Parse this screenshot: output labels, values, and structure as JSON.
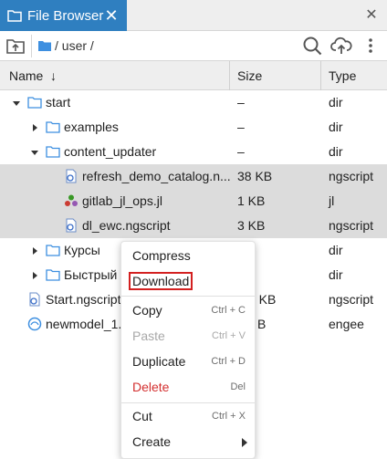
{
  "tab": {
    "title": "File Browser",
    "close_glyph": "✕"
  },
  "panel": {
    "close_glyph": "✕"
  },
  "toolbar": {
    "path": "/ user /"
  },
  "header": {
    "name": "Name",
    "sort_glyph": "↓",
    "size": "Size",
    "type": "Type"
  },
  "rows": [
    {
      "name": "start",
      "size": "–",
      "type": "dir"
    },
    {
      "name": "examples",
      "size": "–",
      "type": "dir"
    },
    {
      "name": "content_updater",
      "size": "–",
      "type": "dir"
    },
    {
      "name": "refresh_demo_catalog.n...",
      "size": "38 KB",
      "type": "ngscript"
    },
    {
      "name": "gitlab_jl_ops.jl",
      "size": "1 KB",
      "type": "jl"
    },
    {
      "name": "dl_ewc.ngscript",
      "size": "3 KB",
      "type": "ngscript"
    },
    {
      "name": "Курсы",
      "size": "",
      "type": "dir"
    },
    {
      "name": "Быстрый",
      "size": "",
      "type": "dir"
    },
    {
      "name": "Start.ngscript",
      "size": "5 KB",
      "type": "ngscript"
    },
    {
      "name": "newmodel_1.",
      "size": "B",
      "type": "engee"
    }
  ],
  "menu": {
    "compress": "Compress",
    "download": "Download",
    "copy": "Copy",
    "copy_sc": "Ctrl + C",
    "paste": "Paste",
    "paste_sc": "Ctrl + V",
    "duplicate": "Duplicate",
    "duplicate_sc": "Ctrl + D",
    "delete": "Delete",
    "delete_sc": "Del",
    "cut": "Cut",
    "cut_sc": "Ctrl + X",
    "create": "Create"
  },
  "colors": {
    "accent": "#2f7fc0",
    "folder": "#3d8fe0",
    "danger": "#d32f2f"
  }
}
